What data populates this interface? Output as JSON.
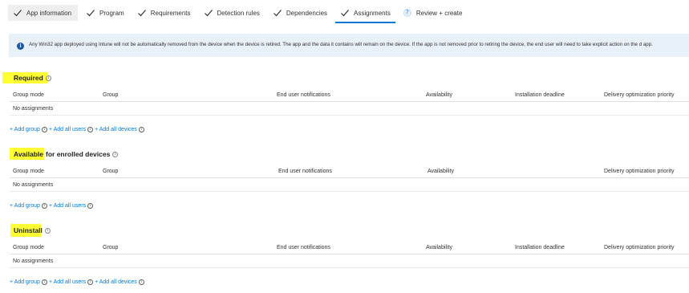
{
  "wizard": {
    "steps": [
      {
        "label": "App information",
        "state": "done"
      },
      {
        "label": "Program",
        "state": "done"
      },
      {
        "label": "Requirements",
        "state": "done"
      },
      {
        "label": "Detection rules",
        "state": "done"
      },
      {
        "label": "Dependencies",
        "state": "done"
      },
      {
        "label": "Assignments",
        "state": "active"
      },
      {
        "label": "Review + create",
        "number": "7",
        "state": "pending"
      }
    ]
  },
  "banner": {
    "icon": "info-icon",
    "text": "Any Win32 app deployed using Intune will not be automatically removed from the device when the device is retired. The app and the data it contains will remain on the device. If the app is not removed prior to retiring the device, the end user will need to take explicit action on the d app."
  },
  "required": {
    "title": "Required",
    "columns": [
      "Group mode",
      "Group",
      "End user notifications",
      "Availability",
      "Installation deadline",
      "Delivery optimization priority"
    ],
    "empty_text": "No assignments",
    "links": {
      "add_group": "+ Add group",
      "add_all_users": "+ Add all users",
      "add_all_devices": "+ Add all devices"
    }
  },
  "available": {
    "title_highlight": "Available",
    "title_rest": "for enrolled devices",
    "columns": [
      "Group mode",
      "Group",
      "End user notifications",
      "Availability",
      "Delivery optimization priority"
    ],
    "empty_text": "No assignments",
    "links": {
      "add_group": "+ Add group",
      "add_all_users": "+ Add all users"
    }
  },
  "uninstall": {
    "title": "Uninstall",
    "columns": [
      "Group mode",
      "Group",
      "End user notifications",
      "Availability",
      "Installation deadline",
      "Delivery optimization priority"
    ],
    "empty_text": "No assignments",
    "links": {
      "add_group": "+ Add group",
      "add_all_users": "+ Add all users",
      "add_all_devices": "+ Add all devices"
    }
  },
  "colors": {
    "highlight": "#ffff33",
    "link": "#0078d4",
    "banner_bg": "#e8f0f8",
    "accent": "#0078d4"
  }
}
